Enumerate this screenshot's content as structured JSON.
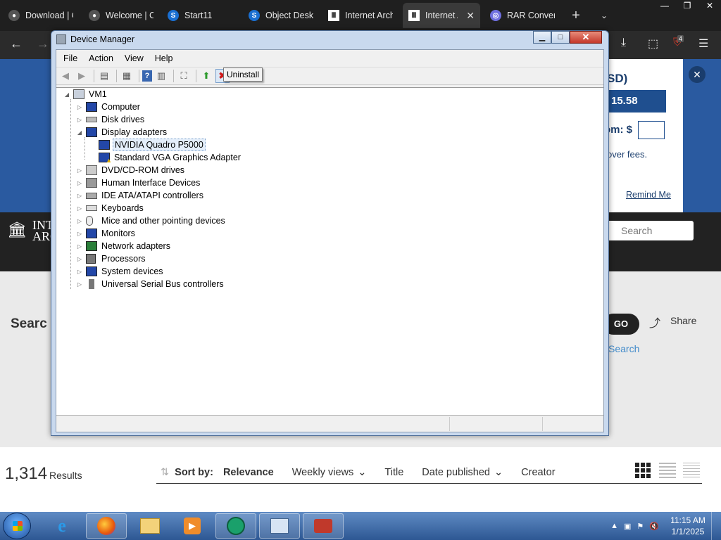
{
  "browser": {
    "tabs": [
      {
        "title": "Download | C",
        "icon": "firefox-icon"
      },
      {
        "title": "Welcome | C",
        "icon": "firefox-icon"
      },
      {
        "title": "Start11",
        "icon": "stardock-icon"
      },
      {
        "title": "Object Deskt",
        "icon": "stardock-icon"
      },
      {
        "title": "Internet Arch",
        "icon": "archive-icon"
      },
      {
        "title": "Internet Ar",
        "icon": "archive-icon",
        "active": true
      },
      {
        "title": "RAR Convert",
        "icon": "rar-converter-icon"
      }
    ],
    "extension_badge": "4"
  },
  "page": {
    "donation": {
      "currency_fragment": "SD)",
      "amount": "15.58",
      "other_label": "om: $",
      "fees_text": "over fees.",
      "remind": "Remind Me"
    },
    "header": {
      "logo_line1": "INT",
      "logo_line2": "ARC",
      "search_placeholder": "Search"
    },
    "search": {
      "title": "Searc",
      "go_label": "GO",
      "share_label": "Share",
      "advanced": "Search"
    },
    "results": {
      "count": "1,314",
      "count_label": "Results",
      "sort_label": "Sort by:",
      "sort_options": [
        "Relevance",
        "Weekly views",
        "Title",
        "Date published",
        "Creator"
      ]
    }
  },
  "device_manager": {
    "title": "Device Manager",
    "menu": [
      "File",
      "Action",
      "View",
      "Help"
    ],
    "tooltip": "Uninstall",
    "root": "VM1",
    "categories": [
      {
        "label": "Computer",
        "icon": "computer-icon"
      },
      {
        "label": "Disk drives",
        "icon": "disk-drive-icon"
      },
      {
        "label": "Display adapters",
        "icon": "display-adapter-icon",
        "expanded": true,
        "children": [
          {
            "label": "NVIDIA Quadro P5000",
            "selected": true
          },
          {
            "label": "Standard VGA Graphics Adapter",
            "warning": true
          }
        ]
      },
      {
        "label": "DVD/CD-ROM drives",
        "icon": "dvd-icon"
      },
      {
        "label": "Human Interface Devices",
        "icon": "hid-icon"
      },
      {
        "label": "IDE ATA/ATAPI controllers",
        "icon": "ide-icon"
      },
      {
        "label": "Keyboards",
        "icon": "keyboard-icon"
      },
      {
        "label": "Mice and other pointing devices",
        "icon": "mouse-icon"
      },
      {
        "label": "Monitors",
        "icon": "monitor-icon"
      },
      {
        "label": "Network adapters",
        "icon": "network-icon"
      },
      {
        "label": "Processors",
        "icon": "processor-icon"
      },
      {
        "label": "System devices",
        "icon": "system-icon"
      },
      {
        "label": "Universal Serial Bus controllers",
        "icon": "usb-icon"
      }
    ]
  },
  "taskbar": {
    "time": "11:15 AM",
    "date": "1/1/2025"
  },
  "colors": {
    "accent": "#2a5aa0",
    "titlebar": "#c9d9ee",
    "close": "#c4382a",
    "taskbar": "#2d5793"
  }
}
